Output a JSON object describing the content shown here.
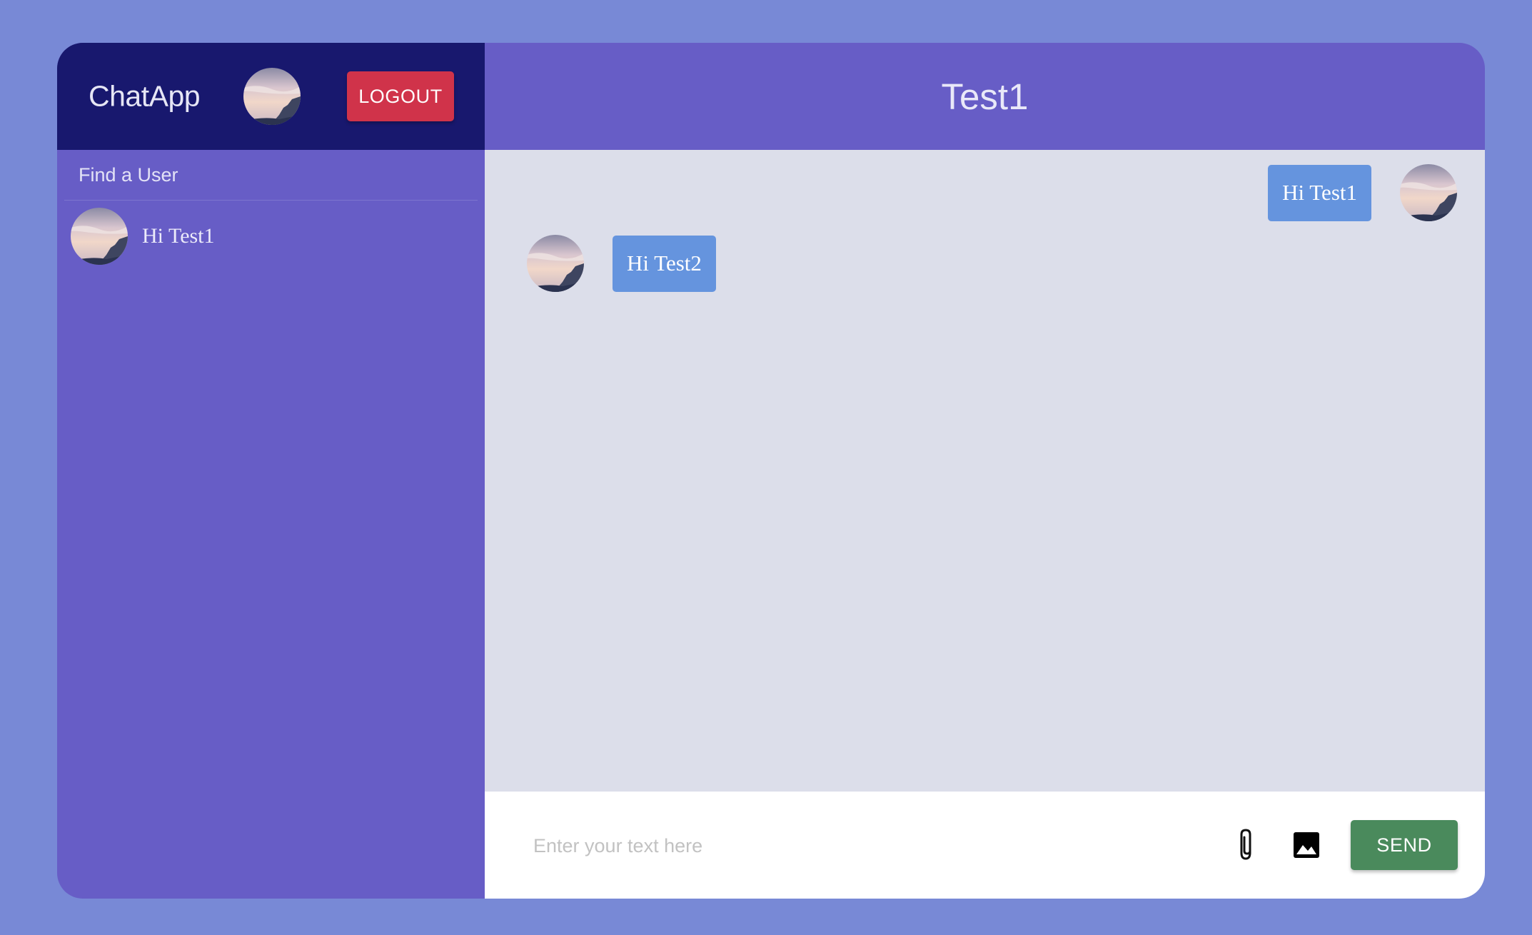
{
  "sidebar": {
    "app_name": "ChatApp",
    "logout_label": "LOGOUT",
    "find_user_label": "Find a User",
    "contacts": [
      {
        "preview": "Hi Test1"
      }
    ]
  },
  "chat": {
    "title": "Test1",
    "messages": [
      {
        "direction": "outgoing",
        "text": "Hi Test1"
      },
      {
        "direction": "incoming",
        "text": "Hi Test2"
      }
    ]
  },
  "composer": {
    "placeholder": "Enter your text here",
    "value": "",
    "attach_icon": "paperclip-icon",
    "image_icon": "image-icon",
    "send_label": "SEND"
  },
  "colors": {
    "page_background": "#7889d6",
    "sidebar_header": "#18186e",
    "sidebar_background": "#675dc6",
    "chat_header": "#675dc6",
    "messages_background": "#dcdeea",
    "bubble": "#6594de",
    "logout_button": "#d0334a",
    "send_button": "#4a8a5c"
  }
}
